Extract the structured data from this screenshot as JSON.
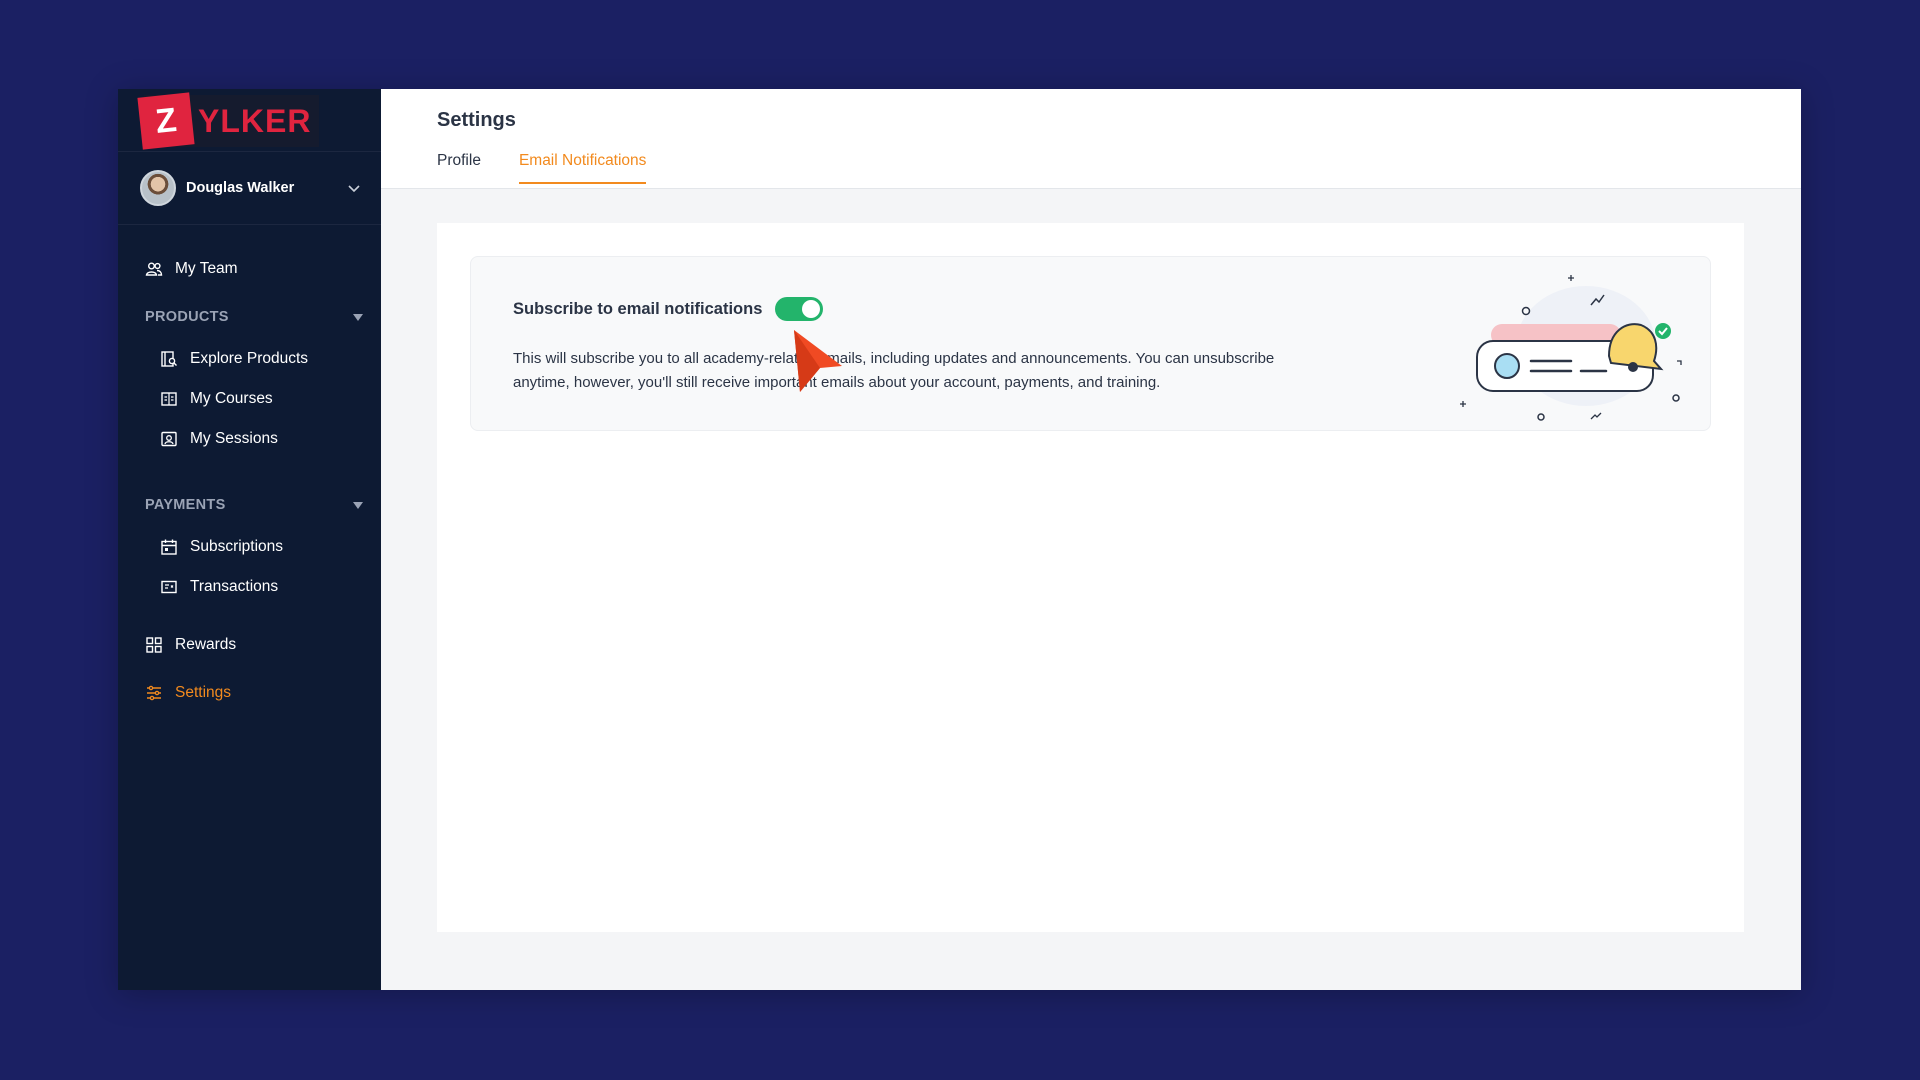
{
  "brand": {
    "logo_letter": "Z",
    "logo_text": "YLKER"
  },
  "user": {
    "name": "Douglas Walker"
  },
  "sidebar": {
    "my_team": "My Team",
    "products": {
      "label": "PRODUCTS",
      "items": [
        "Explore Products",
        "My Courses",
        "My Sessions"
      ]
    },
    "payments": {
      "label": "PAYMENTS",
      "items": [
        "Subscriptions",
        "Transactions"
      ]
    },
    "rewards": "Rewards",
    "settings": "Settings"
  },
  "header": {
    "title": "Settings",
    "tabs": [
      "Profile",
      "Email Notifications"
    ],
    "active_tab": "Email Notifications"
  },
  "email_card": {
    "title": "Subscribe to email notifications",
    "toggle_on": true,
    "description": "This will subscribe you to all academy-related emails, including updates and announcements. You can unsubscribe anytime, however, you'll still receive important emails about your account, payments, and training."
  },
  "colors": {
    "accent": "#f28a1e",
    "toggle_on": "#23b46b",
    "sidebar_bg": "#0d1a33",
    "logo_red": "#e0243f",
    "backdrop": "#1b2063"
  }
}
